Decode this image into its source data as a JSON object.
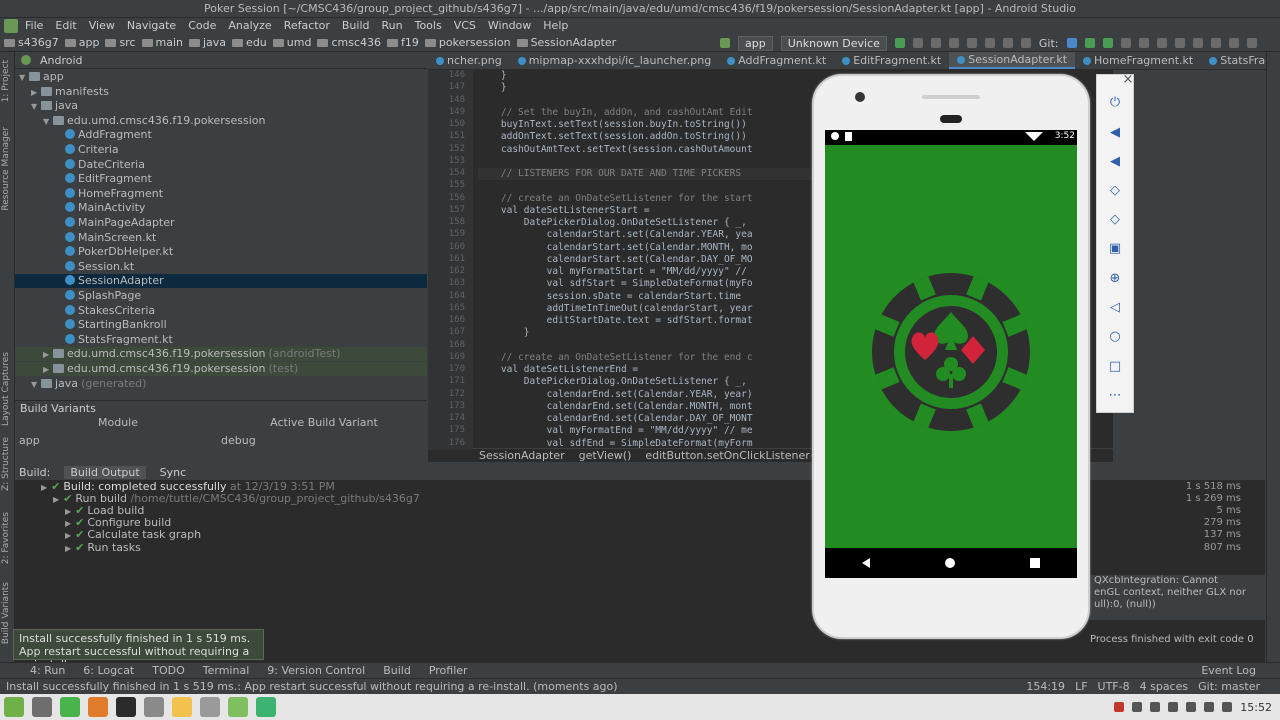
{
  "window": {
    "title": "Poker Session [~/CMSC436/group_project_github/s436g7] - .../app/src/main/java/edu/umd/cmsc436/f19/pokersession/SessionAdapter.kt [app] - Android Studio"
  },
  "menu": [
    "File",
    "Edit",
    "View",
    "Navigate",
    "Code",
    "Analyze",
    "Refactor",
    "Build",
    "Run",
    "Tools",
    "VCS",
    "Window",
    "Help"
  ],
  "breadcrumbs": [
    "s436g7",
    "app",
    "src",
    "main",
    "java",
    "edu",
    "umd",
    "cmsc436",
    "f19",
    "pokersession",
    "SessionAdapter"
  ],
  "toolbar": {
    "run_config": "app",
    "device": "Unknown Device",
    "git_label": "Git:"
  },
  "project_panel": {
    "view": "Android",
    "tree": [
      {
        "label": "app",
        "depth": 0,
        "type": "folder",
        "expanded": true
      },
      {
        "label": "manifests",
        "depth": 1,
        "type": "folder",
        "expanded": false
      },
      {
        "label": "java",
        "depth": 1,
        "type": "folder",
        "expanded": true
      },
      {
        "label": "edu.umd.cmsc436.f19.pokersession",
        "depth": 2,
        "type": "folder",
        "expanded": true
      },
      {
        "label": "AddFragment",
        "depth": 3,
        "type": "kotlin"
      },
      {
        "label": "Criteria",
        "depth": 3,
        "type": "kotlin"
      },
      {
        "label": "DateCriteria",
        "depth": 3,
        "type": "kotlin"
      },
      {
        "label": "EditFragment",
        "depth": 3,
        "type": "kotlin"
      },
      {
        "label": "HomeFragment",
        "depth": 3,
        "type": "kotlin"
      },
      {
        "label": "MainActivity",
        "depth": 3,
        "type": "kotlin"
      },
      {
        "label": "MainPageAdapter",
        "depth": 3,
        "type": "kotlin"
      },
      {
        "label": "MainScreen.kt",
        "depth": 3,
        "type": "kotlin"
      },
      {
        "label": "PokerDbHelper.kt",
        "depth": 3,
        "type": "kotlin"
      },
      {
        "label": "Session.kt",
        "depth": 3,
        "type": "kotlin"
      },
      {
        "label": "SessionAdapter",
        "depth": 3,
        "type": "kotlin",
        "selected": true
      },
      {
        "label": "SplashPage",
        "depth": 3,
        "type": "kotlin"
      },
      {
        "label": "StakesCriteria",
        "depth": 3,
        "type": "kotlin"
      },
      {
        "label": "StartingBankroll",
        "depth": 3,
        "type": "kotlin"
      },
      {
        "label": "StatsFragment.kt",
        "depth": 3,
        "type": "kotlin"
      },
      {
        "label": "edu.umd.cmsc436.f19.pokersession",
        "suffix": "(androidTest)",
        "depth": 2,
        "type": "folder",
        "test": true
      },
      {
        "label": "edu.umd.cmsc436.f19.pokersession",
        "suffix": "(test)",
        "depth": 2,
        "type": "folder",
        "test": true
      },
      {
        "label": "java",
        "suffix": "(generated)",
        "depth": 1,
        "type": "folder",
        "expanded": true
      }
    ]
  },
  "build_variants": {
    "title": "Build Variants",
    "col_module": "Module",
    "col_variant": "Active Build Variant",
    "rows": [
      {
        "module": "app",
        "variant": "debug"
      }
    ]
  },
  "editor_tabs": [
    {
      "label": "ncher.png",
      "active": false
    },
    {
      "label": "mipmap-xxxhdpi/ic_launcher.png",
      "active": false
    },
    {
      "label": "AddFragment.kt",
      "active": false
    },
    {
      "label": "EditFragment.kt",
      "active": false
    },
    {
      "label": "SessionAdapter.kt",
      "active": true
    },
    {
      "label": "HomeFragment.kt",
      "active": false
    },
    {
      "label": "StatsFragment.kt",
      "active": false
    }
  ],
  "line_numbers": [
    "146",
    "147",
    "148",
    "149",
    "150",
    "151",
    "152",
    "153",
    "154",
    "155",
    "156",
    "157",
    "158",
    "159",
    "160",
    "161",
    "162",
    "163",
    "164",
    "165",
    "166",
    "167",
    "168",
    "169",
    "170",
    "171",
    "172",
    "173",
    "174",
    "175",
    "176"
  ],
  "code_lines": [
    "    }",
    "    }",
    "",
    "    // Set the buyIn, addOn, and cashOutAmt Edit",
    "    buyInText.setText(session.buyIn.toString())",
    "    addOnText.setText(session.addOn.toString())",
    "    cashOutAmtText.setText(session.cashOutAmount",
    "",
    "    // LISTENERS FOR OUR DATE AND TIME PICKERS",
    "",
    "    // create an OnDateSetListener for the start",
    "    val dateSetListenerStart =",
    "        DatePickerDialog.OnDateSetListener { _,",
    "            calendarStart.set(Calendar.YEAR, yea",
    "            calendarStart.set(Calendar.MONTH, mo",
    "            calendarStart.set(Calendar.DAY_OF_MO",
    "            val myFormatStart = \"MM/dd/yyyy\" //",
    "            val sdfStart = SimpleDateFormat(myFo",
    "            session.sDate = calendarStart.time",
    "            addTimeInTimeOut(calendarStart, year",
    "            editStartDate.text = sdfStart.format",
    "        }",
    "",
    "    // create an OnDateSetListener for the end c",
    "    val dateSetListenerEnd =",
    "        DatePickerDialog.OnDateSetListener { _,",
    "            calendarEnd.set(Calendar.YEAR, year)",
    "            calendarEnd.set(Calendar.MONTH, mont",
    "            calendarEnd.set(Calendar.DAY_OF_MONT",
    "            val myFormatEnd = \"MM/dd/yyyy\" // me",
    "            val sdfEnd = SimpleDateFormat(myForm"
  ],
  "editor_breadcrumb": [
    "SessionAdapter",
    "getView()",
    "editButton.setOnClickListener{...}"
  ],
  "build": {
    "tabs": [
      "Build:",
      "Build Output",
      "Sync"
    ],
    "rows": [
      {
        "text": "Build: completed successfully",
        "suffix": " at 12/3/19 3:51 PM",
        "time": "1 s 518 ms",
        "depth": 0
      },
      {
        "text": "Run build",
        "suffix": " /home/tuttle/CMSC436/group_project_github/s436g7",
        "time": "1 s 269 ms",
        "depth": 1
      },
      {
        "text": "Load build",
        "suffix": "",
        "time": "5 ms",
        "depth": 2
      },
      {
        "text": "Configure build",
        "suffix": "",
        "time": "279 ms",
        "depth": 2
      },
      {
        "text": "Calculate task graph",
        "suffix": "",
        "time": "137 ms",
        "depth": 2
      },
      {
        "text": "Run tasks",
        "suffix": "",
        "time": "807 ms",
        "depth": 2
      }
    ]
  },
  "logcat_snippet": [
    "QXcbIntegration: Cannot",
    "enGL context, neither GLX nor",
    "ull):0, (null))",
    "Process finished with exit code 0"
  ],
  "toast": {
    "line1": "Install successfully finished in 1 s 519 ms.",
    "line2": "App restart successful without requiring a re-install."
  },
  "bottom_tabs": [
    "4: Run",
    "6: Logcat",
    "TODO",
    "Terminal",
    "9: Version Control",
    "Build",
    "Profiler",
    "Event Log"
  ],
  "status": {
    "message": "Install successfully finished in 1 s 519 ms.: App restart successful without requiring a re-install. (moments ago)",
    "position": "154:19",
    "line_sep": "LF",
    "encoding": "UTF-8",
    "indent": "4 spaces",
    "git": "Git: master"
  },
  "phone": {
    "time": "3:52"
  },
  "clock": "15:52",
  "side_tabs": [
    "1: Project",
    "Resource Manager",
    "Layout Captures",
    "Z: Structure",
    "2: Favorites",
    "Build Variants"
  ],
  "colors": {
    "felt": "#228b22",
    "chip": "#2e2e2e",
    "chip_inner": "#1f5e1f",
    "red_suit": "#d1233a"
  }
}
